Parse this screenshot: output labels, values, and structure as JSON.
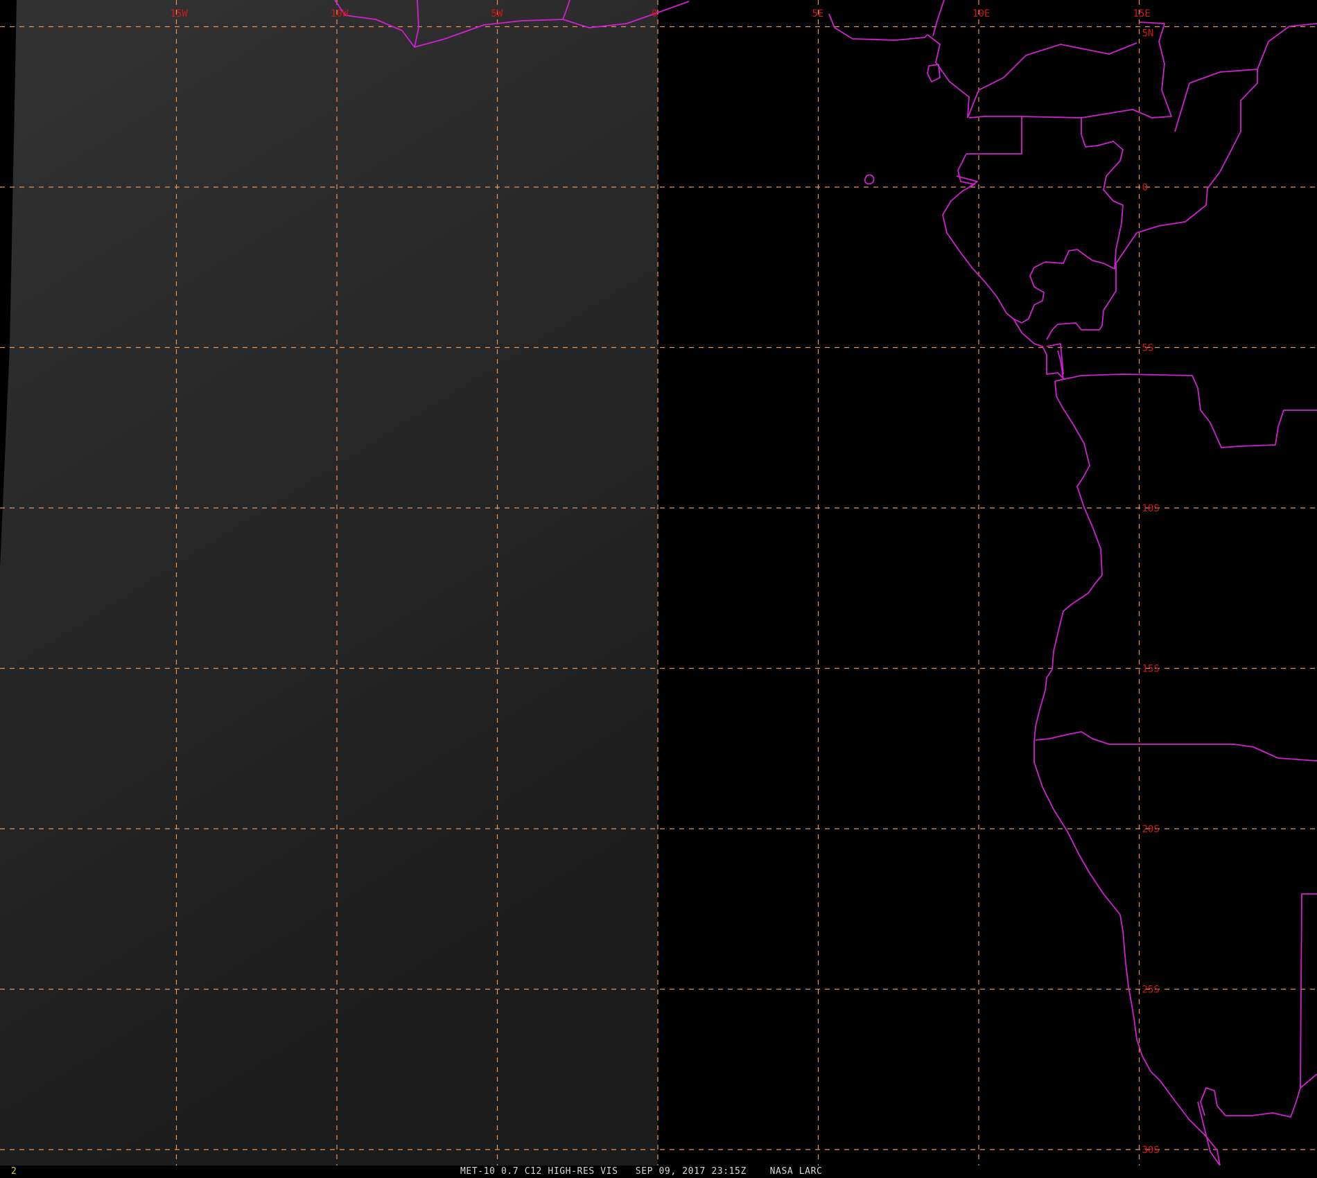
{
  "map": {
    "colors": {
      "background": "#000000",
      "imagery_day": "#2c2c2c",
      "graticule": "#e8955a",
      "boundaries": "#d020d0",
      "tick_labels": "#d01818",
      "frame_number": "#e0d020",
      "caption": "#d8d8d8"
    },
    "graticule": {
      "longitudes": [
        -15,
        -10,
        -5,
        0,
        5,
        10,
        15
      ],
      "latitudes": [
        5,
        0,
        -5,
        -10,
        -15,
        -20,
        -25,
        -30
      ],
      "longitude_labels": [
        "15W",
        "10W",
        "5W",
        "0",
        "5E",
        "10E",
        "15E"
      ],
      "latitude_labels": [
        "5N",
        "0",
        "5S",
        "10S",
        "15S",
        "20S",
        "25S",
        "30S"
      ]
    },
    "frame_number": "2",
    "caption": "MET-10 0.7 C12 HIGH-RES VIS   SEP 09, 2017 23:15Z    NASA LARC"
  }
}
